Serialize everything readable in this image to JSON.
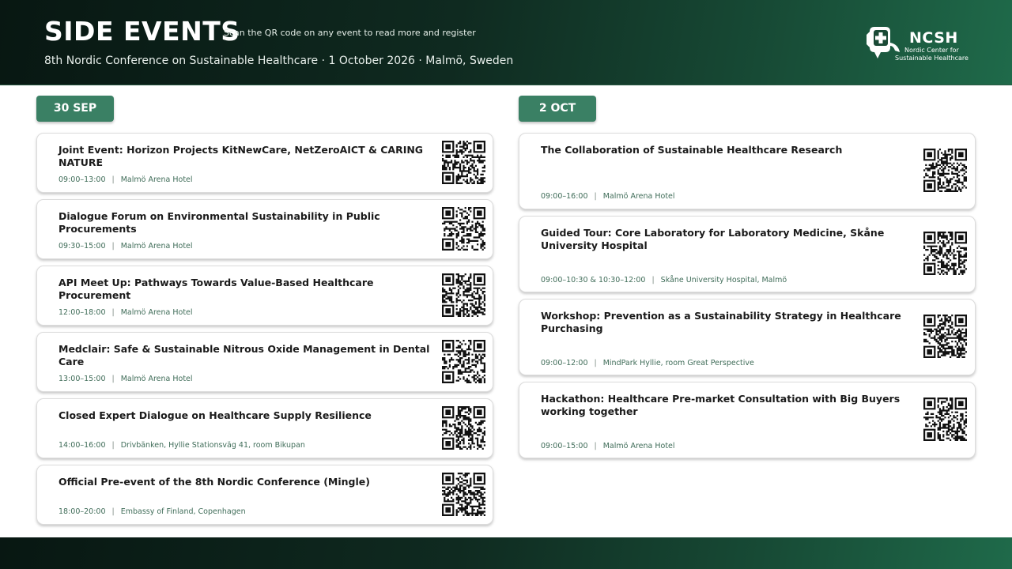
{
  "header": {
    "title": "SIDE EVENTS",
    "scan_note": "Scan the QR code on any event to read more and register",
    "subtitle": "8th Nordic Conference on Sustainable Healthcare · 1 October 2026 · Malmö, Sweden",
    "logo": {
      "name": "NCSH",
      "line1": "Nordic Center for",
      "line2": "Sustainable Healthcare"
    }
  },
  "columns": [
    {
      "day": "30 SEP",
      "events": [
        {
          "title": "Joint Event: Horizon Projects KitNewCare, NetZeroAICT & CARING NATURE",
          "time": "09:00–13:00",
          "location": "Malmö Arena Hotel"
        },
        {
          "title": "Dialogue Forum on Environmental Sustainability in Public Procurements",
          "time": "09:30–15:00",
          "location": "Malmö Arena Hotel"
        },
        {
          "title": "API Meet Up: Pathways Towards Value-Based Healthcare Procurement",
          "time": "12:00–18:00",
          "location": "Malmö Arena Hotel"
        },
        {
          "title": "Medclair: Safe & Sustainable Nitrous Oxide Management in Dental Care",
          "time": "13:00–15:00",
          "location": "Malmö Arena Hotel"
        },
        {
          "title": "Closed Expert Dialogue on Healthcare Supply Resilience",
          "time": "14:00–16:00",
          "location": "Drivbänken, Hyllie Stationsväg 41, room Bikupan"
        },
        {
          "title": "Official Pre-event of the 8th Nordic Conference (Mingle)",
          "time": "18:00–20:00",
          "location": "Embassy of Finland, Copenhagen"
        }
      ]
    },
    {
      "day": "2 OCT",
      "events": [
        {
          "title": "The Collaboration of Sustainable Healthcare Research",
          "time": "09:00–16:00",
          "location": "Malmö Arena Hotel"
        },
        {
          "title": "Guided Tour: Core Laboratory for Laboratory Medicine, Skåne University Hospital",
          "time": "09:00–10:30 & 10:30–12:00",
          "location": "Skåne University Hospital, Malmö"
        },
        {
          "title": "Workshop: Prevention as a Sustainability Strategy in Healthcare Purchasing",
          "time": "09:00–12:00",
          "location": "MindPark Hyllie, room Great Perspective"
        },
        {
          "title": "Hackathon: Healthcare Pre-market Consultation with Big Buyers working together",
          "time": "09:00–15:00",
          "location": "Malmö Arena Hotel"
        }
      ]
    }
  ],
  "colors": {
    "accent": "#3a8064",
    "header_dark": "#0f2a20",
    "meta_text": "#3f6c58"
  },
  "icons": {
    "qr": "qr-code-icon",
    "logo": "ncsh-logo-icon"
  }
}
